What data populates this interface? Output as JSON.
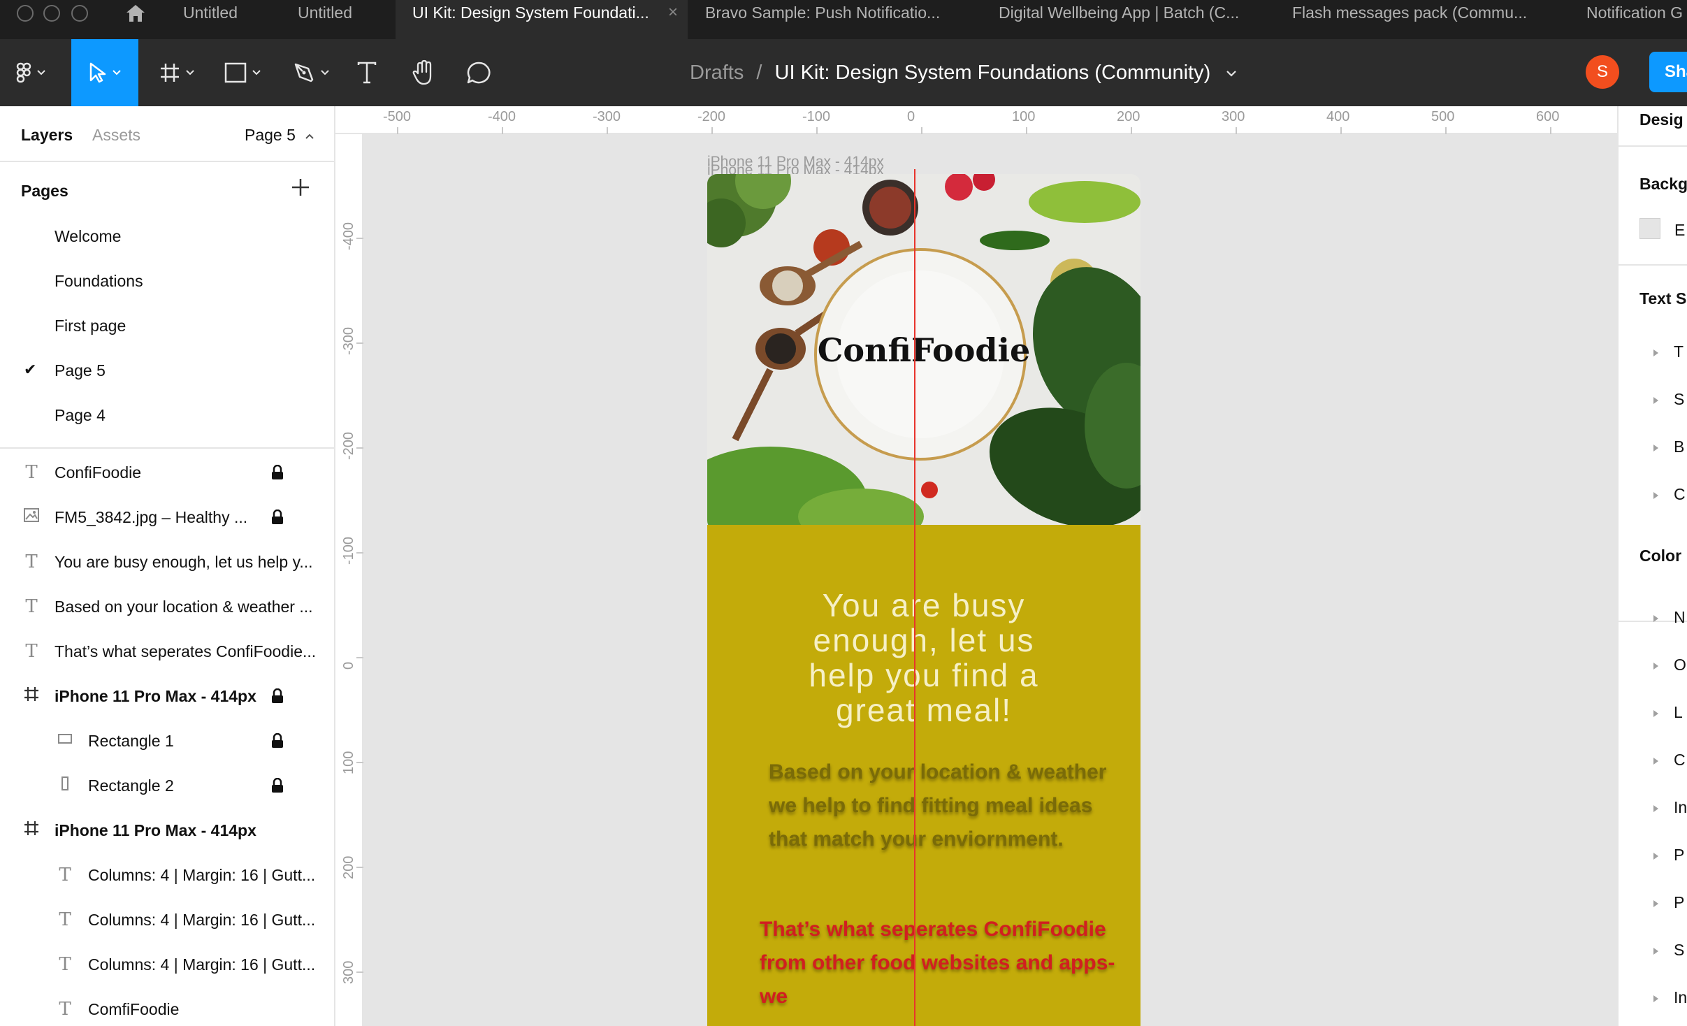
{
  "tabs": [
    {
      "label": "Untitled",
      "active": false
    },
    {
      "label": "Untitled",
      "active": false
    },
    {
      "label": "UI Kit: Design System Foundati...",
      "active": true
    },
    {
      "label": "Bravo Sample: Push Notificatio...",
      "active": false
    },
    {
      "label": "Digital Wellbeing App | Batch (C...",
      "active": false
    },
    {
      "label": "Flash messages pack (Commu...",
      "active": false
    },
    {
      "label": "Notification G",
      "active": false
    }
  ],
  "tab_close_glyph": "×",
  "toolbar": {
    "breadcrumb_parent": "Drafts",
    "breadcrumb_sep": "/",
    "file_title": "UI Kit: Design System Foundations (Community)",
    "avatar_initial": "S",
    "share_label": "Sha"
  },
  "left_panel": {
    "tab_layers": "Layers",
    "tab_assets": "Assets",
    "current_page": "Page 5",
    "pages_title": "Pages",
    "pages": [
      {
        "name": "Welcome",
        "selected": false
      },
      {
        "name": "Foundations",
        "selected": false
      },
      {
        "name": "First page",
        "selected": false
      },
      {
        "name": "Page 5",
        "selected": true
      },
      {
        "name": "Page 4",
        "selected": false
      }
    ],
    "layers": [
      {
        "name": "ConfiFoodie",
        "icon": "text-icon",
        "locked": true,
        "indent": 0,
        "bold": false
      },
      {
        "name": "FM5_3842.jpg – Healthy ...",
        "icon": "image-icon",
        "locked": true,
        "indent": 0,
        "bold": false
      },
      {
        "name": "You are busy enough, let us help y...",
        "icon": "text-icon",
        "locked": false,
        "indent": 0,
        "bold": false
      },
      {
        "name": "Based on your location & weather ...",
        "icon": "text-icon",
        "locked": false,
        "indent": 0,
        "bold": false
      },
      {
        "name": "That’s what seperates ConfiFoodie...",
        "icon": "text-icon",
        "locked": false,
        "indent": 0,
        "bold": false
      },
      {
        "name": "iPhone 11 Pro Max - 414px",
        "icon": "frame-icon",
        "locked": true,
        "indent": 0,
        "bold": true
      },
      {
        "name": "Rectangle 1",
        "icon": "rectangle-icon",
        "locked": true,
        "indent": 1,
        "bold": false
      },
      {
        "name": "Rectangle 2",
        "icon": "rectangle-tall-icon",
        "locked": true,
        "indent": 1,
        "bold": false
      },
      {
        "name": "iPhone 11 Pro Max - 414px",
        "icon": "frame-icon",
        "locked": false,
        "indent": 0,
        "bold": true
      },
      {
        "name": "Columns: 4 | Margin: 16 | Gutt...",
        "icon": "text-icon",
        "locked": false,
        "indent": 1,
        "bold": false
      },
      {
        "name": "Columns: 4 | Margin: 16 | Gutt...",
        "icon": "text-icon",
        "locked": false,
        "indent": 1,
        "bold": false
      },
      {
        "name": "Columns: 4 | Margin: 16 | Gutt...",
        "icon": "text-icon",
        "locked": false,
        "indent": 1,
        "bold": false
      },
      {
        "name": "ComfiFoodie",
        "icon": "text-icon",
        "locked": false,
        "indent": 1,
        "bold": false
      }
    ]
  },
  "rulers": {
    "top_labels": [
      "-500",
      "-400",
      "-300",
      "-200",
      "-100",
      "0",
      "100",
      "200",
      "300",
      "400",
      "500",
      "600"
    ],
    "left_labels": [
      "-400",
      "-300",
      "-200",
      "-100",
      "0",
      "100",
      "200",
      "300"
    ]
  },
  "canvas": {
    "frame_label": "iPhone 11 Pro Max - 414px",
    "brand": "ConfiFoodie",
    "tagline": "You are busy enough, let us help you find a great meal!",
    "based_text": "Based on your location & weather we help to find fitting meal ideas that match your enviornment.",
    "seperates_text": "That’s what seperates  ConfiFoodie from other food websites and apps- we",
    "panel_color": "#c3ab0a",
    "guide_color": "#e8342c"
  },
  "right_panel": {
    "design_tab": "Desig",
    "background_title": "Backg",
    "background_value": "E",
    "text_styles_title": "Text S",
    "text_styles": [
      "T",
      "S",
      "B",
      "C"
    ],
    "color_title": "Color",
    "colors": [
      "N",
      "O",
      "L",
      "C",
      "In",
      "P",
      "P",
      "S",
      "In"
    ]
  },
  "colors": {
    "accent": "#0d99ff",
    "avatar": "#f24e1e"
  }
}
